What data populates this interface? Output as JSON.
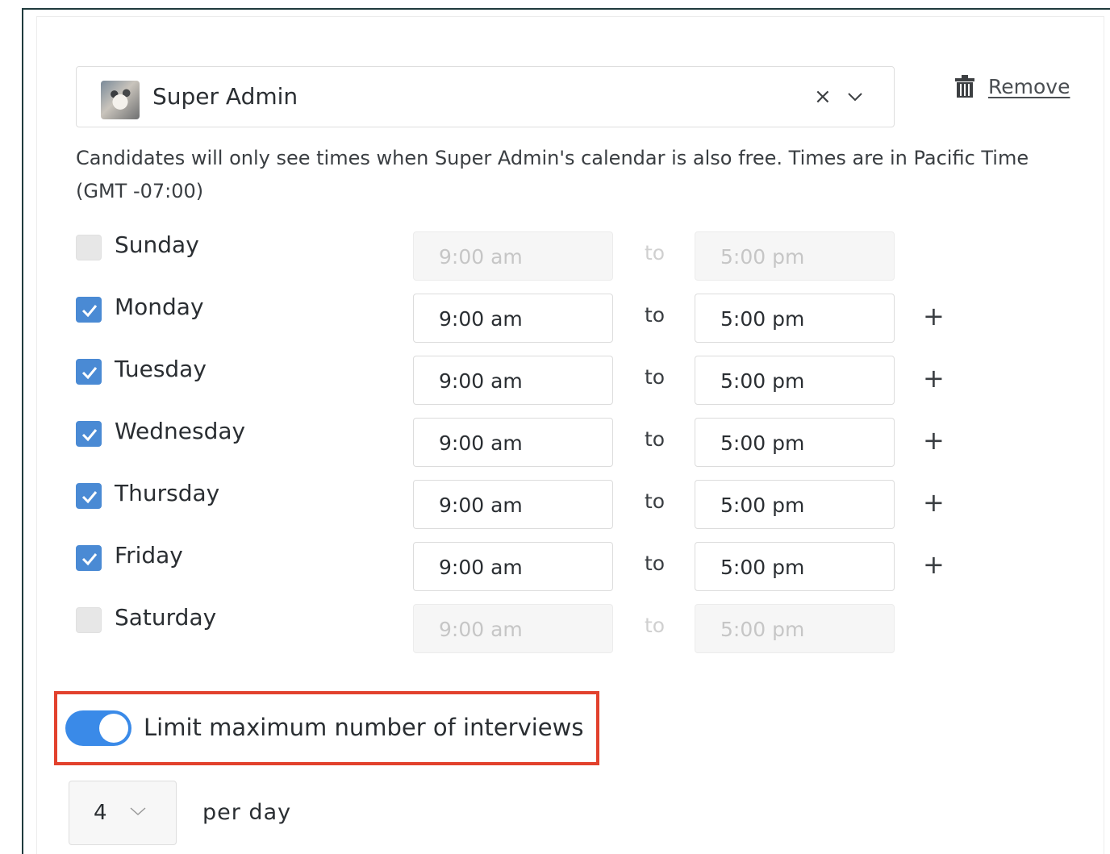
{
  "user_select": {
    "name": "Super Admin",
    "clear_glyph": "×",
    "remove_label": "Remove"
  },
  "info_text": "Candidates will only see times when Super Admin's calendar is also free. Times are in Pacific Time (GMT -07:00)",
  "days": [
    {
      "label": "Sunday",
      "checked": false,
      "from": "9:00 am",
      "to_label": "to",
      "to": "5:00 pm"
    },
    {
      "label": "Monday",
      "checked": true,
      "from": "9:00 am",
      "to_label": "to",
      "to": "5:00 pm"
    },
    {
      "label": "Tuesday",
      "checked": true,
      "from": "9:00 am",
      "to_label": "to",
      "to": "5:00 pm"
    },
    {
      "label": "Wednesday",
      "checked": true,
      "from": "9:00 am",
      "to_label": "to",
      "to": "5:00 pm"
    },
    {
      "label": "Thursday",
      "checked": true,
      "from": "9:00 am",
      "to_label": "to",
      "to": "5:00 pm"
    },
    {
      "label": "Friday",
      "checked": true,
      "from": "9:00 am",
      "to_label": "to",
      "to": "5:00 pm"
    },
    {
      "label": "Saturday",
      "checked": false,
      "from": "9:00 am",
      "to_label": "to",
      "to": "5:00 pm"
    }
  ],
  "add_glyph": "+",
  "limit": {
    "label": "Limit maximum number of interviews",
    "enabled": true,
    "value": "4",
    "per_label": "per day"
  },
  "colors": {
    "accent": "#3a8ae8",
    "checkbox": "#4a8ad4",
    "highlight_border": "#e2412d"
  }
}
